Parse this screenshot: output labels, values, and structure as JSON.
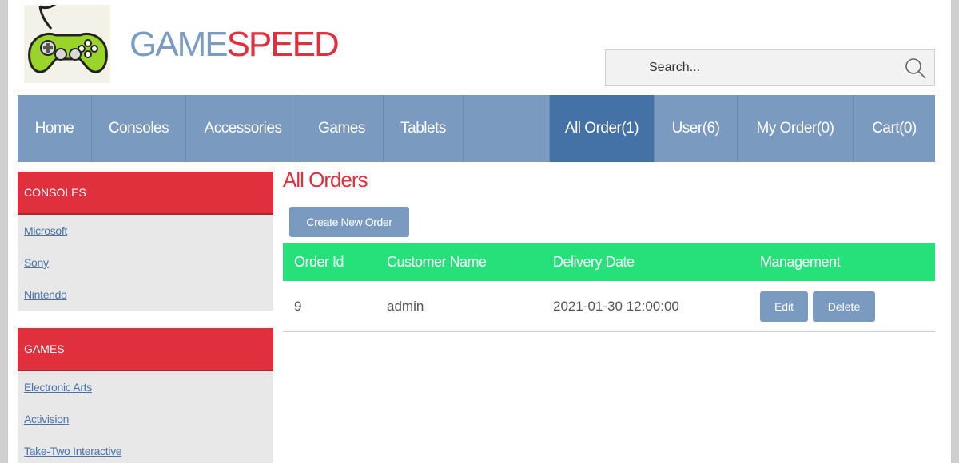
{
  "brand": {
    "part1": "GAME",
    "part2": "SPEED"
  },
  "search": {
    "placeholder": "Search..."
  },
  "nav": {
    "items": [
      "Home",
      "Consoles",
      "Accessories",
      "Games",
      "Tablets",
      ""
    ],
    "right_items": [
      "All Order(1)",
      "User(6)",
      "My Order(0)",
      "Cart(0)"
    ],
    "active": "All Order(1)"
  },
  "sidebar": {
    "consoles": {
      "heading": "CONSOLES",
      "links": [
        "Microsoft",
        "Sony",
        "Nintendo"
      ]
    },
    "games": {
      "heading": "GAMES",
      "links": [
        "Electronic Arts",
        "Activision",
        "Take-Two Interactive"
      ]
    }
  },
  "main": {
    "title": "All Orders",
    "create_label": "Create New Order",
    "columns": [
      "Order Id",
      "Customer Name",
      "Delivery Date",
      "Management"
    ],
    "rows": [
      {
        "id": "9",
        "customer": "admin",
        "date": "2021-01-30 12:00:00",
        "edit": "Edit",
        "delete": "Delete"
      }
    ]
  },
  "colors": {
    "brand_blue": "#7a9bbf",
    "accent_red": "#e0303e",
    "table_green": "#26e07a",
    "nav_active": "#4572a6"
  }
}
